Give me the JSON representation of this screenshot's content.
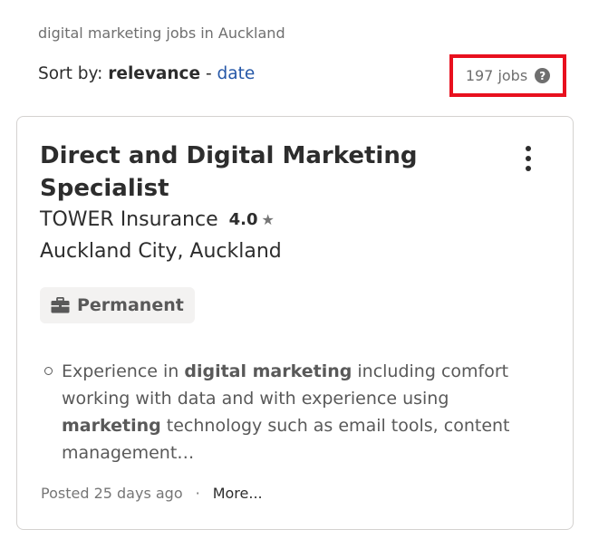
{
  "search": {
    "query_label": "digital marketing jobs in Auckland"
  },
  "sort": {
    "prefix": "Sort by:",
    "active": "relevance",
    "separator": "-",
    "alternative": "date"
  },
  "results": {
    "count_text": "197 jobs",
    "help_glyph": "?"
  },
  "job": {
    "title": "Direct and Digital Marketing Specialist",
    "company": "TOWER Insurance",
    "rating": "4.0",
    "star_glyph": "★",
    "location": "Auckland City, Auckland",
    "job_type": "Permanent",
    "snippet": {
      "part1": "Experience in ",
      "bold1": "digital marketing",
      "part2": " including comfort working with data and with experience using ",
      "bold2": "marketing",
      "part3": " technology such as email tools, content management…"
    },
    "posted": "Posted 25 days ago",
    "footer_sep": "·",
    "more_label": "More..."
  },
  "colors": {
    "highlight_border": "#e8101e",
    "link": "#2557a7",
    "text_primary": "#2d2d2d",
    "text_secondary": "#6f6f6f"
  }
}
